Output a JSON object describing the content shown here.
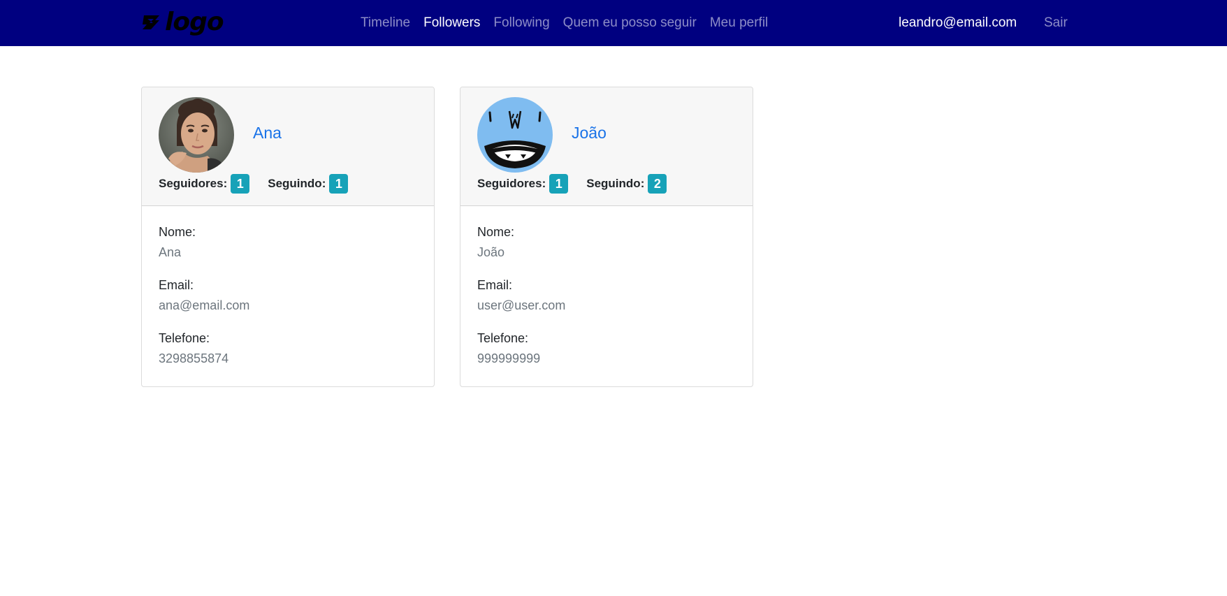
{
  "navbar": {
    "logo_text": "logo",
    "links": [
      {
        "label": "Timeline",
        "active": false
      },
      {
        "label": "Followers",
        "active": true
      },
      {
        "label": "Following",
        "active": false
      },
      {
        "label": "Quem eu posso seguir",
        "active": false
      },
      {
        "label": "Meu perfil",
        "active": false
      }
    ],
    "user_email": "leandro@email.com",
    "logout_label": "Sair",
    "background_color": "#000080"
  },
  "labels": {
    "followers": "Seguidores:",
    "following": "Seguindo:",
    "name": "Nome:",
    "email": "Email:",
    "phone": "Telefone:"
  },
  "cards": [
    {
      "display_name": "Ana",
      "avatar": "woman-photo-avatar",
      "followers_count": "1",
      "following_count": "1",
      "name": "Ana",
      "email": "ana@email.com",
      "phone": "3298855874"
    },
    {
      "display_name": "João",
      "avatar": "blue-monster-avatar",
      "followers_count": "1",
      "following_count": "2",
      "name": "João",
      "email": "user@user.com",
      "phone": "999999999"
    }
  ],
  "colors": {
    "link": "#1a73e8",
    "badge": "#17a2b8",
    "muted": "#6c757d"
  }
}
